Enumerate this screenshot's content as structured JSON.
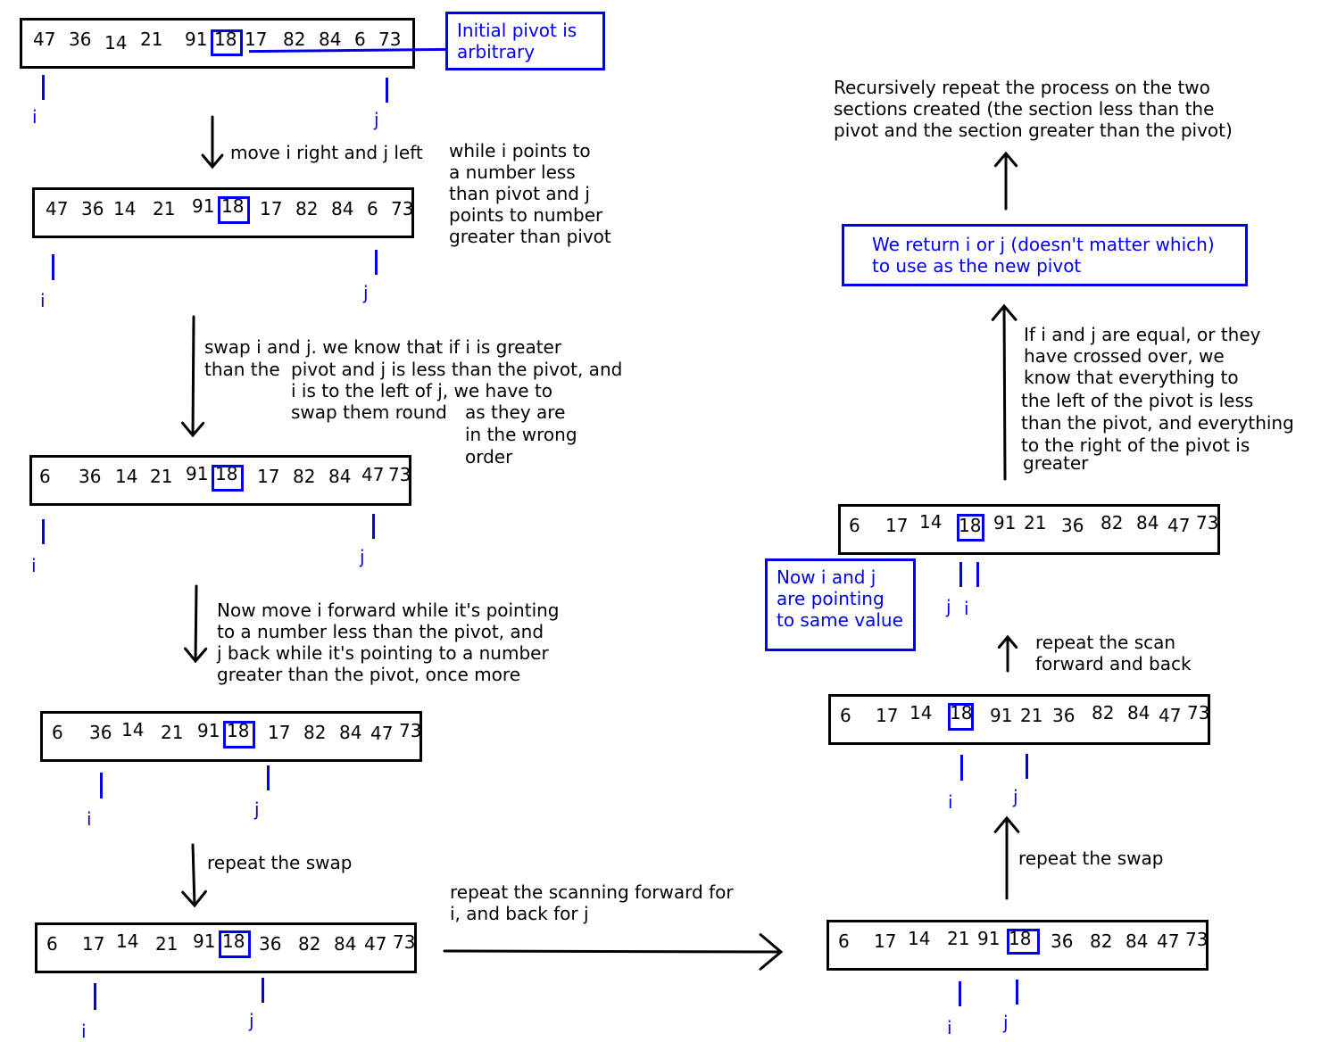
{
  "arrays": [
    {
      "id": "step1",
      "values": [
        "47",
        "36",
        "14",
        "21",
        "91",
        "18",
        "17",
        "82",
        "84",
        "6",
        "73"
      ],
      "pivot_index": 5,
      "pointers": {
        "i": "i",
        "j": "j"
      }
    },
    {
      "id": "step2",
      "values": [
        "47",
        "36",
        "14",
        "21",
        "91",
        "18",
        "17",
        "82",
        "84",
        "6",
        "73"
      ],
      "pivot_index": 5,
      "pointers": {
        "i": "i",
        "j": "j"
      }
    },
    {
      "id": "step3",
      "values": [
        "6",
        "36",
        "14",
        "21",
        "91",
        "18",
        "17",
        "82",
        "84",
        "47",
        "73"
      ],
      "pivot_index": 5,
      "pointers": {
        "i": "i",
        "j": "j"
      }
    },
    {
      "id": "step4",
      "values": [
        "6",
        "36",
        "14",
        "21",
        "91",
        "18",
        "17",
        "82",
        "84",
        "47",
        "73"
      ],
      "pivot_index": 5,
      "pointers": {
        "i": "i",
        "j": "j"
      }
    },
    {
      "id": "step5",
      "values": [
        "6",
        "17",
        "14",
        "21",
        "91",
        "18",
        "36",
        "82",
        "84",
        "47",
        "73"
      ],
      "pivot_index": 5,
      "pointers": {
        "i": "i",
        "j": "j"
      }
    },
    {
      "id": "step6",
      "values": [
        "6",
        "17",
        "14",
        "21",
        "91",
        "18",
        "36",
        "82",
        "84",
        "47",
        "73"
      ],
      "pivot_index": 5,
      "pointers": {
        "i": "i",
        "j": "j"
      }
    },
    {
      "id": "step7",
      "values": [
        "6",
        "17",
        "14",
        "18",
        "91",
        "21",
        "36",
        "82",
        "84",
        "47",
        "73"
      ],
      "pivot_index": 3,
      "pointers": {
        "i": "i",
        "j": "j"
      }
    },
    {
      "id": "step8",
      "values": [
        "6",
        "17",
        "14",
        "18",
        "91",
        "21",
        "36",
        "82",
        "84",
        "47",
        "73"
      ],
      "pivot_index": 3,
      "pointers": {
        "i": "i",
        "j": "j"
      }
    }
  ],
  "notes": {
    "initial_pivot": [
      "Initial pivot is",
      "arbitrary"
    ],
    "return_pivot": [
      "We return i or j (doesn't matter which)",
      "to use as the new pivot"
    ],
    "same_value": [
      "Now i and j",
      "are pointing",
      "to same value"
    ]
  },
  "captions": {
    "move": [
      "move i right and j left"
    ],
    "while": [
      "while i points to",
      "a number less",
      "than pivot and j",
      "points to number",
      "greater than pivot"
    ],
    "swap": [
      "swap i and j. we know that if i is greater",
      "than the",
      "pivot and j is less than the pivot, and",
      "i is to the left of j, we have to",
      "swap them round",
      "as they are",
      "in the wrong",
      "order"
    ],
    "move_again": [
      "Now move i forward while it's pointing",
      "to a number less than the pivot, and",
      "j back while it's pointing to a number",
      "greater than the pivot, once more"
    ],
    "repeat_swap_left": [
      "repeat the swap"
    ],
    "repeat_scan_right": [
      "repeat the scanning forward for",
      "i, and back for j"
    ],
    "repeat_swap_right": [
      "repeat the swap"
    ],
    "repeat_scan_fb": [
      "repeat the scan",
      "forward and back"
    ],
    "equal": [
      "If i and j are equal, or they",
      "have crossed over, we",
      "know that everything to",
      "the left of the pivot is less",
      "than the pivot, and everything",
      "to the right of the pivot is",
      "greater"
    ],
    "recurse": [
      "Recursively repeat the process on the two",
      "sections created (the section less than the",
      "pivot and the section greater than the pivot)"
    ]
  },
  "colors": {
    "pointer": "#0000ee",
    "ink": "#000000"
  }
}
